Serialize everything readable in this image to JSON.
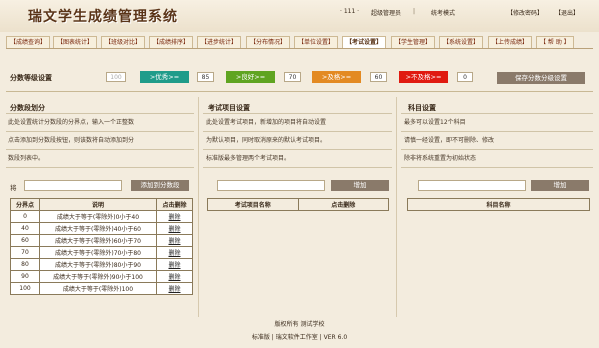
{
  "app": {
    "title": "瑞文学生成绩管理系统",
    "user_id": "· 111 ·",
    "role": "超级管理员",
    "mode": "统考模式",
    "change_password": "【修改密码】",
    "logout": "【退出】",
    "separator": "|"
  },
  "nav": {
    "tabs": [
      {
        "label": "【成绩查询】"
      },
      {
        "label": "【图表统计】"
      },
      {
        "label": "【班级对比】"
      },
      {
        "label": "【成绩排序】"
      },
      {
        "label": "【进步统计】"
      },
      {
        "label": "【分布情况】"
      },
      {
        "label": "【单位设置】"
      },
      {
        "label": "【考试设置】"
      },
      {
        "label": "【学生管理】"
      },
      {
        "label": "【系统设置】"
      },
      {
        "label": "【上传成绩】"
      },
      {
        "label": "【 帮 助 】"
      }
    ]
  },
  "grade_settings": {
    "label": "分数等级设置",
    "max_value": "100",
    "excellent_label": ">优秀>=",
    "excellent_value": "85",
    "good_label": ">良好>=",
    "good_value": "70",
    "pass_label": ">及格>=",
    "pass_value": "60",
    "fail_label": ">不及格>=",
    "fail_value": "0",
    "save_button": "保存分数分级设置",
    "colors": {
      "excellent": "#1f9c8a",
      "good": "#5fa421",
      "pass": "#e38a22",
      "fail": "#e01a10"
    }
  },
  "segments": {
    "title": "分数段划分",
    "desc1": "此处设置统计分数段的分界点，输入一个正整数",
    "desc2": "点击添加到分数段按钮，则该数将自动添加到分",
    "desc3": "数段列表中。",
    "input_label": "将",
    "add_button": "添加到分数段",
    "columns": {
      "point": "分界点",
      "desc": "说明",
      "action": "点击删除"
    },
    "rows": [
      {
        "point": "0",
        "desc": "成绩大于等于(零除外)0小于40",
        "action": "删除"
      },
      {
        "point": "40",
        "desc": "成绩大于等于(零除外)40小于60",
        "action": "删除"
      },
      {
        "point": "60",
        "desc": "成绩大于等于(零除外)60小于70",
        "action": "删除"
      },
      {
        "point": "70",
        "desc": "成绩大于等于(零除外)70小于80",
        "action": "删除"
      },
      {
        "point": "80",
        "desc": "成绩大于等于(零除外)80小于90",
        "action": "删除"
      },
      {
        "point": "90",
        "desc": "成绩大于等于(零除外)90小于100",
        "action": "删除"
      },
      {
        "point": "100",
        "desc": "成绩大于等于(零除外)100",
        "action": "删除"
      }
    ]
  },
  "exam_items": {
    "title": "考试项目设置",
    "desc1": "此处设置考试项目，新增加的项目将自动设置",
    "desc2": "为默认项目，同时取消原来的默认考试项目。",
    "desc3": "标准版最多管理两个考试项目。",
    "add_button": "增加",
    "columns": {
      "name": "考试项目名称",
      "action": "点击删除"
    }
  },
  "subjects": {
    "title": "科目设置",
    "desc1": "最多可以设置12个科目",
    "desc2": "请慎一经设置，即不可删除、修改",
    "desc3": "除非将系统重置为初始状态",
    "add_button": "增加",
    "columns": {
      "name": "科目名称"
    }
  },
  "footer": {
    "copyright": "版权所有 测试学校",
    "edition": "标准版",
    "studio": "瑞文软件工作室",
    "version": "VER 6.0",
    "separator": "|"
  }
}
